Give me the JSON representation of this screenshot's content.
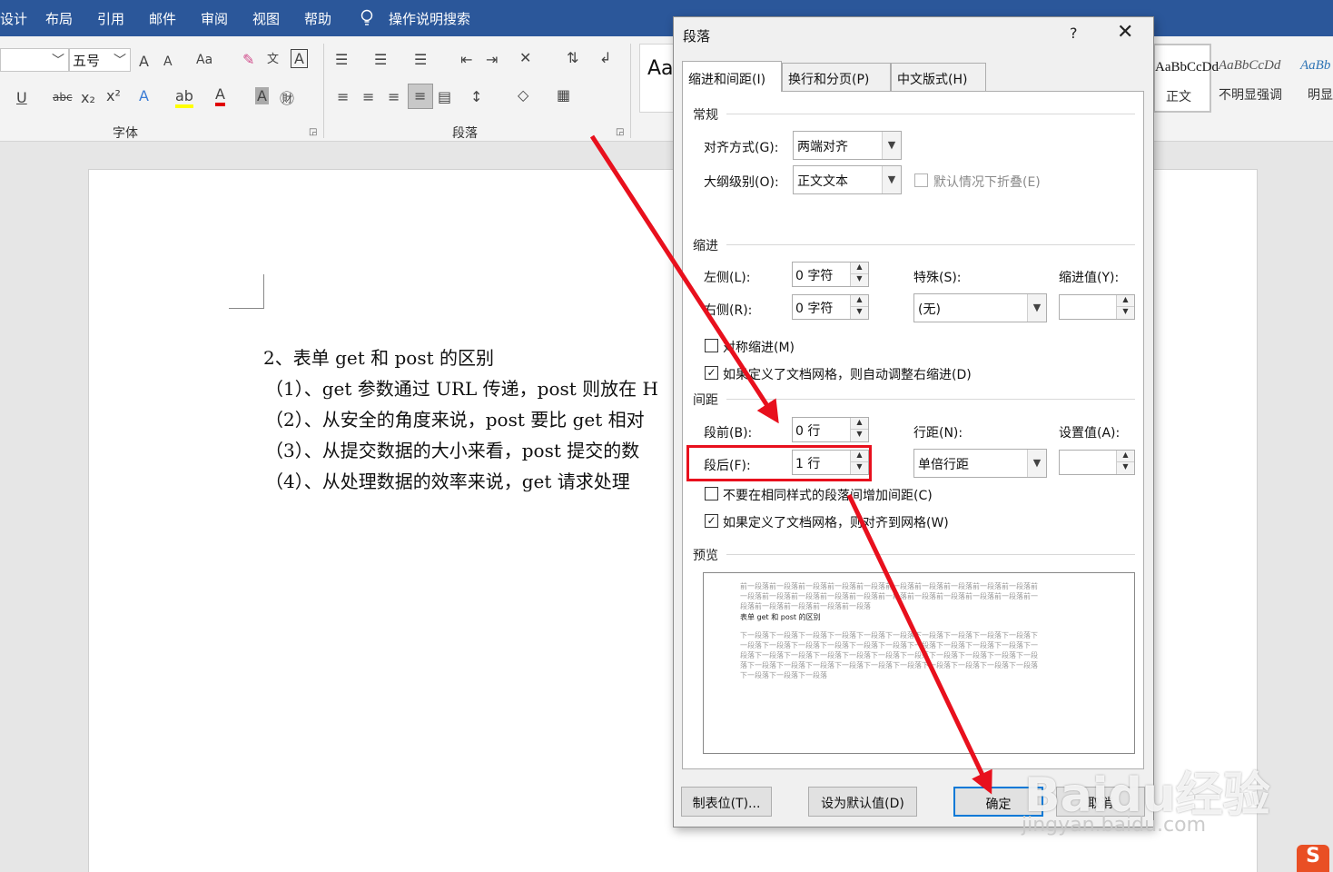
{
  "menubar": {
    "items": [
      "设计",
      "布局",
      "引用",
      "邮件",
      "审阅",
      "视图",
      "帮助"
    ],
    "search": "操作说明搜索"
  },
  "ribbon": {
    "font_size": "五号",
    "font_group": "字体",
    "paragraph_group": "段落",
    "grow_font": "A",
    "shrink_font": "A",
    "change_case": "Aa",
    "styles": [
      {
        "sample": "AaBbCcDd",
        "name": "正文"
      },
      {
        "sample": "AaBbCcDd",
        "name": "不明显强调"
      },
      {
        "sample": "AaBb",
        "name": "明显"
      }
    ],
    "style_heading_sample": "Aa"
  },
  "document": {
    "lines": [
      "2、表单 get 和 post 的区别",
      "（1）、get 参数通过 URL 传递，post 则放在 H",
      "（2）、从安全的角度来说，post 要比 get 相对",
      "（3）、从提交数据的大小来看，post 提交的数",
      "（4）、从处理数据的效率来说，get 请求处理"
    ]
  },
  "dialog": {
    "title": "段落",
    "help": "?",
    "close": "✕",
    "tabs": [
      "缩进和间距(I)",
      "换行和分页(P)",
      "中文版式(H)"
    ],
    "general": {
      "title": "常规",
      "alignment_label": "对齐方式(G):",
      "alignment_value": "两端对齐",
      "outline_label": "大纲级别(O):",
      "outline_value": "正文文本",
      "collapse_label": "默认情况下折叠(E)"
    },
    "indent": {
      "title": "缩进",
      "left_label": "左侧(L):",
      "left_value": "0 字符",
      "right_label": "右侧(R):",
      "right_value": "0 字符",
      "special_label": "特殊(S):",
      "special_value": "(无)",
      "indent_value_label": "缩进值(Y):",
      "mirror_label": "对称缩进(M)",
      "auto_adjust_label": "如果定义了文档网格，则自动调整右缩进(D)"
    },
    "spacing": {
      "title": "间距",
      "before_label": "段前(B):",
      "before_value": "0 行",
      "after_label": "段后(F):",
      "after_value": "1 行",
      "line_spacing_label": "行距(N):",
      "line_spacing_value": "单倍行距",
      "at_label": "设置值(A):",
      "no_space_label": "不要在相同样式的段落间增加间距(C)",
      "snap_grid_label": "如果定义了文档网格，则对齐到网格(W)"
    },
    "preview": {
      "title": "预览",
      "prev_lines": [
        "前一段落前一段落前一段落前一段落前一段落前一段落前一段落前一段落前一段落前一段落前",
        "一段落前一段落前一段落前一段落前一段落前一段落前一段落前一段落前一段落前一段落前一",
        "段落前一段落前一段落前一段落前一段落"
      ],
      "current_line": "表单 get 和 post 的区别",
      "next_lines": [
        "下一段落下一段落下一段落下一段落下一段落下一段落下一段落下一段落下一段落下一段落下",
        "一段落下一段落下一段落下一段落下一段落下一段落下一段落下一段落下一段落下一段落下一",
        "段落下一段落下一段落下一段落下一段落下一段落下一段落下一段落下一段落下一段落下一段",
        "落下一段落下一段落下一段落下一段落下一段落下一段落下一段落下一段落下一段落下一段落",
        "下一段落下一段落下一段落"
      ]
    },
    "buttons": {
      "tabs": "制表位(T)...",
      "set_default": "设为默认值(D)",
      "ok": "确定",
      "cancel": "取消"
    }
  },
  "watermark": {
    "logo": "Baidu经验",
    "url": "jingyan.baidu.com",
    "sogou": "S"
  },
  "colors": {
    "titlebar": "#2b579a",
    "annotation": "#e8101d",
    "default_button": "#0078d7"
  }
}
